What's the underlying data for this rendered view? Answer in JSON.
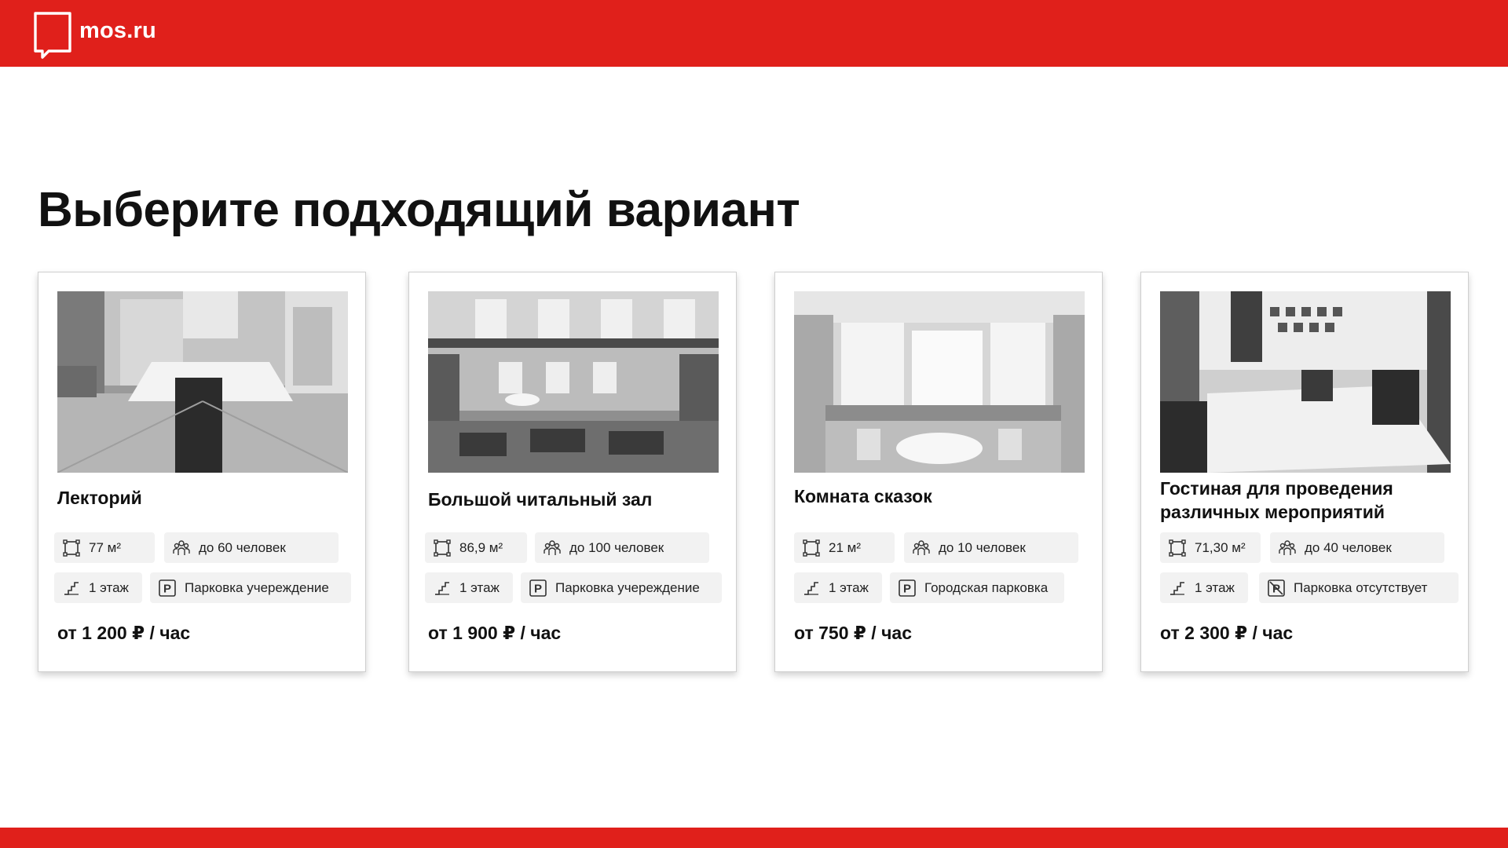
{
  "header": {
    "logo_text": "mos.ru",
    "brand_color": "#e0201b"
  },
  "page_title": "Выберите подходящий вариант",
  "cards": [
    {
      "name": "Лекторий",
      "area": "77 м²",
      "capacity": "до 60 человек",
      "floor": "1 этаж",
      "parking": "Парковка учереждение",
      "price": "от 1 200 ₽ / час"
    },
    {
      "name": "Большой читальный зал",
      "area": "86,9 м²",
      "capacity": "до 100 человек",
      "floor": "1 этаж",
      "parking": "Парковка учереждение",
      "price": "от 1 900 ₽ / час"
    },
    {
      "name": "Комната сказок",
      "area": "21  м²",
      "capacity": "до 10 человек",
      "floor": "1 этаж",
      "parking": "Городская парковка",
      "price": "от 750 ₽ / час"
    },
    {
      "name": "Гостиная для проведения различных мероприятий",
      "area": "71,30  м²",
      "capacity": "до 40 человек",
      "floor": "1 этаж",
      "parking": "Парковка отсутствует",
      "price": "от 2 300 ₽ / час"
    }
  ],
  "icons": {
    "logo": "speech-bubble-icon",
    "area": "area-frame-icon",
    "capacity": "people-group-icon",
    "floor": "stairs-icon",
    "parking": "parking-icon",
    "no_parking": "no-parking-icon"
  }
}
